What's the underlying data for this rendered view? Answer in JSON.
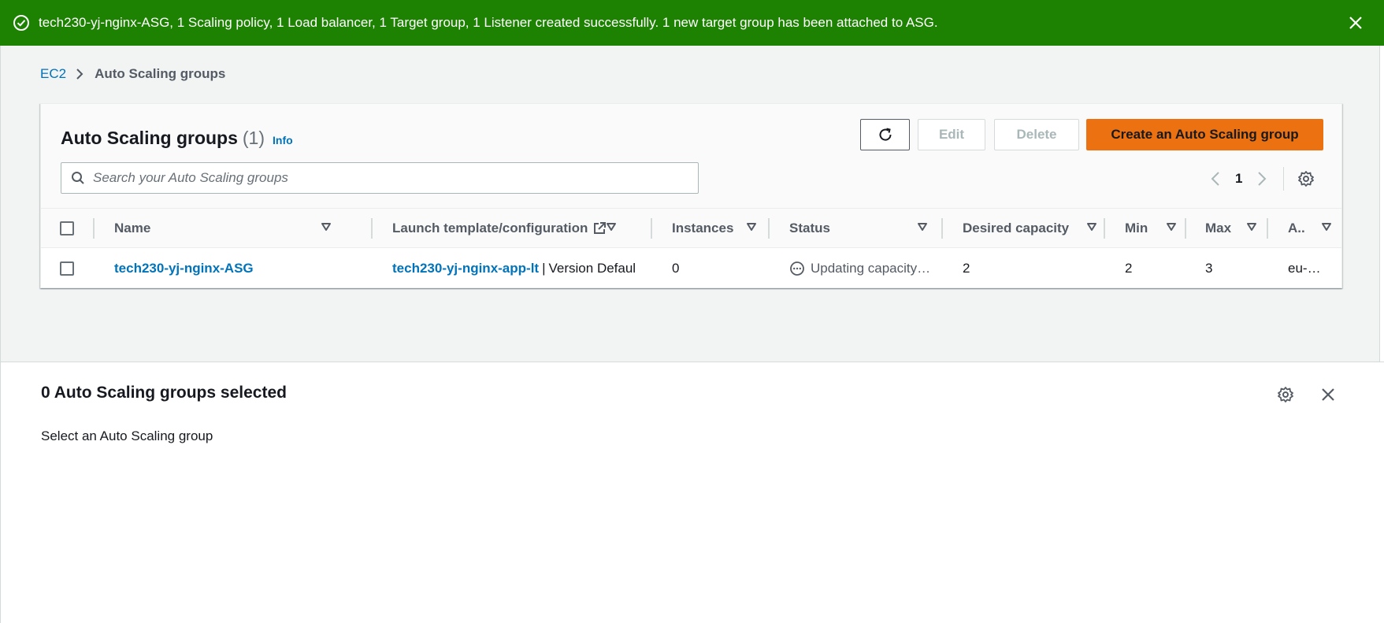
{
  "flash": {
    "message": "tech230-yj-nginx-ASG, 1 Scaling policy, 1 Load balancer, 1 Target group, 1 Listener created successfully. 1 new target group has been attached to ASG.",
    "icon": "success-check-icon",
    "color": "#1d8102"
  },
  "breadcrumb": {
    "root": "EC2",
    "current": "Auto Scaling groups"
  },
  "panel": {
    "title": "Auto Scaling groups",
    "count": "(1)",
    "info": "Info",
    "edit_label": "Edit",
    "delete_label": "Delete",
    "create_label": "Create an Auto Scaling group",
    "accent_color": "#ec7211",
    "search_placeholder": "Search your Auto Scaling groups",
    "page_number": "1"
  },
  "table": {
    "columns": {
      "name": "Name",
      "launch": "Launch template/configuration",
      "instances": "Instances",
      "status": "Status",
      "desired": "Desired capacity",
      "min": "Min",
      "max": "Max",
      "az": "A.."
    },
    "rows": [
      {
        "name": "tech230-yj-nginx-ASG",
        "launch_template": "tech230-yj-nginx-app-lt",
        "separator": "|",
        "version": "Version Defaul",
        "instances": "0",
        "status": "Updating capacity…",
        "desired": "2",
        "min": "2",
        "max": "3",
        "az": "eu-…"
      }
    ]
  },
  "split_panel": {
    "title": "0 Auto Scaling groups selected",
    "body": "Select an Auto Scaling group"
  }
}
